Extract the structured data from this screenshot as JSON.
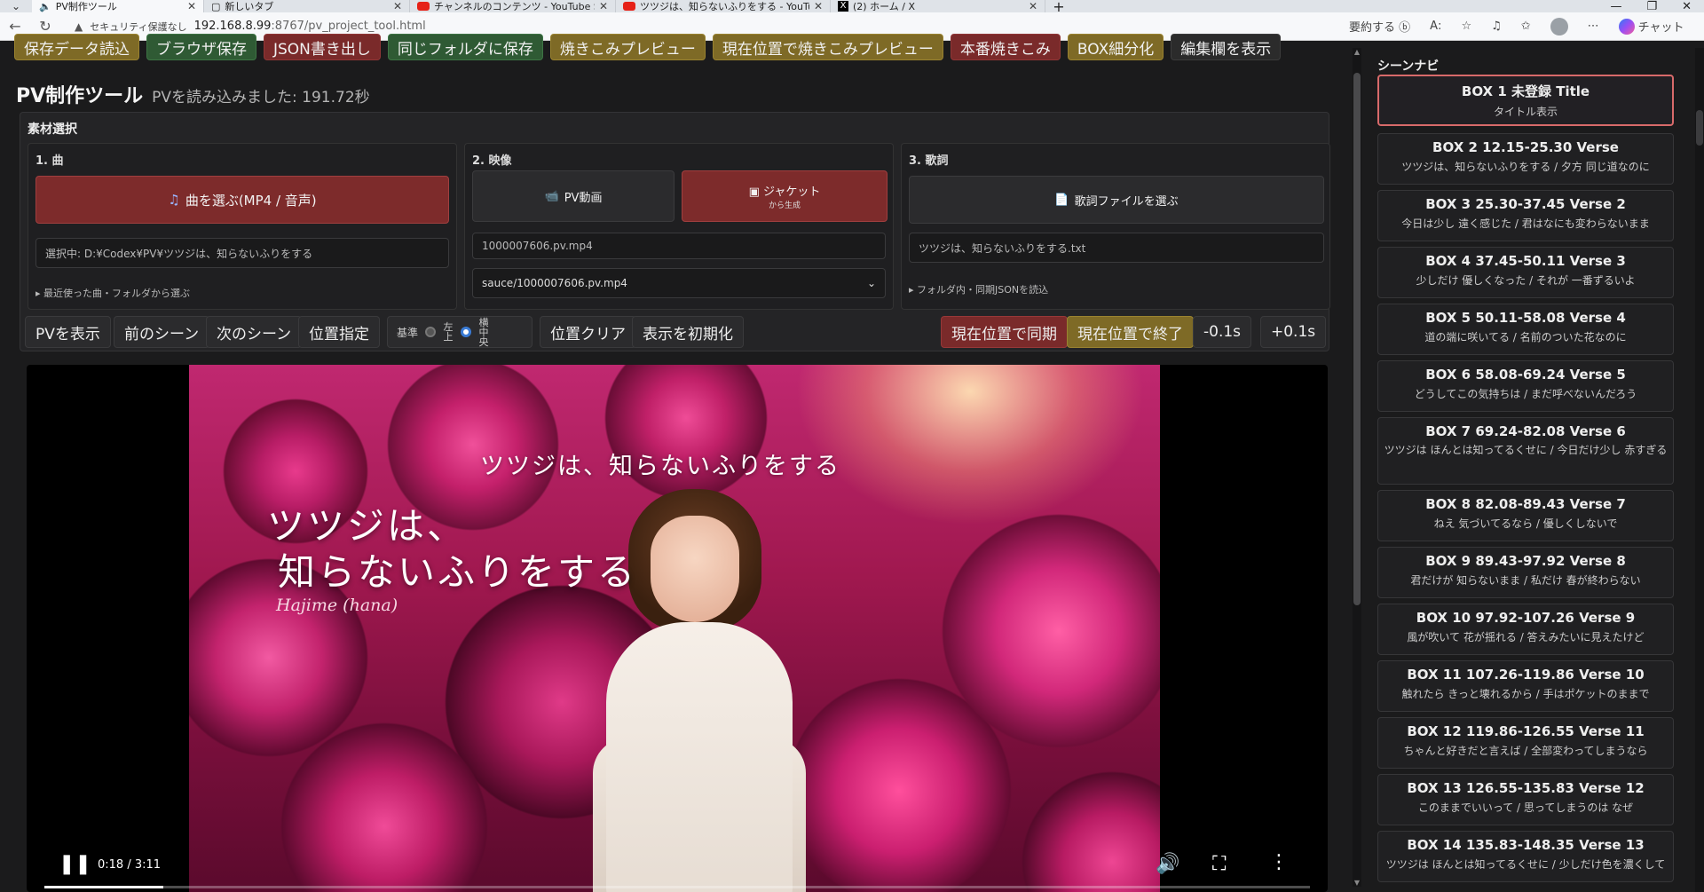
{
  "browser": {
    "tabs": [
      {
        "label": "PV制作ツール",
        "active": true,
        "icon": "speaker-icon"
      },
      {
        "label": "新しいタブ",
        "active": false,
        "icon": "page-icon"
      },
      {
        "label": "チャンネルのコンテンツ - YouTube Studio",
        "active": false,
        "icon": "youtube-icon"
      },
      {
        "label": "ツツジは、知らないふりをする - YouTube",
        "active": false,
        "icon": "youtube-icon"
      },
      {
        "label": "(2) ホーム / X",
        "active": false,
        "icon": "x-icon"
      }
    ],
    "security_label": "セキュリティ保護なし",
    "url_host": "192.168.8.99",
    "url_path": ":8767/pv_project_tool.html",
    "summarize_label": "要約する",
    "chat_label": "チャット"
  },
  "toolbar": {
    "buttons": [
      {
        "label": "保存データ読込",
        "style": "gd"
      },
      {
        "label": "ブラウザ保存",
        "style": "g"
      },
      {
        "label": "JSON書き出し",
        "style": "rd"
      },
      {
        "label": "同じフォルダに保存",
        "style": "g"
      },
      {
        "label": "焼きこみプレビュー",
        "style": "gd"
      },
      {
        "label": "現在位置で焼きこみプレビュー",
        "style": "gd"
      },
      {
        "label": "本番焼きこみ",
        "style": "rd"
      },
      {
        "label": "BOX細分化",
        "style": "gd"
      },
      {
        "label": "編集欄を表示",
        "style": "dk"
      }
    ]
  },
  "header": {
    "title": "PV制作ツール",
    "status": "PVを読み込みました: 191.72秒"
  },
  "materials": {
    "title": "素材選択",
    "song": {
      "heading": "1. 曲",
      "pick_label": "曲を選ぶ(MP4 / 音声)",
      "selected_text": "選択中: D:¥Codex¥PV¥ツツジは、知らないふりをする",
      "recent_link": "▸ 最近使った曲・フォルダから選ぶ"
    },
    "video": {
      "heading": "2. 映像",
      "pv_button": "PV動画",
      "jacket_button": "ジャケット",
      "jacket_sub": "から生成",
      "file_name": "1000007606.pv.mp4",
      "select_value": "sauce/1000007606.pv.mp4"
    },
    "lyrics": {
      "heading": "3. 歌詞",
      "pick_label": "歌詞ファイルを選ぶ",
      "file_name": "ツツジは、知らないふりをする.txt",
      "json_link": "▸ フォルダ内・同期JSONを読込"
    }
  },
  "controls": {
    "show_pv": "PVを表示",
    "prev_scene": "前のシーン",
    "next_scene": "次のシーン",
    "position": "位置指定",
    "basis_label": "基準",
    "radio_topleft": "左上",
    "radio_center": "横中央",
    "selected_radio": "横中央",
    "clear_position": "位置クリア",
    "reset_display": "表示を初期化",
    "sync_here": "現在位置で同期",
    "end_here": "現在位置で終了",
    "minus": "-0.1s",
    "plus": "+0.1s"
  },
  "video": {
    "overlay_top": "ツツジは、知らないふりをする",
    "overlay_line1": "ツツジは、",
    "overlay_line2": "知らないふりをする",
    "overlay_signature": "Hajime (hana)",
    "time": "0:18 / 3:11",
    "progress": 0.094
  },
  "scene_nav": {
    "title": "シーンナビ",
    "items": [
      {
        "head": "BOX 1 未登録 Title",
        "sub": "タイトル表示",
        "active": true
      },
      {
        "head": "BOX 2 12.15-25.30 Verse",
        "sub": "ツツジは、知らないふりをする / 夕方 同じ道なのに"
      },
      {
        "head": "BOX 3 25.30-37.45 Verse 2",
        "sub": "今日は少し 遠く感じた / 君はなにも変わらないまま"
      },
      {
        "head": "BOX 4 37.45-50.11 Verse 3",
        "sub": "少しだけ 優しくなった / それが 一番ずるいよ"
      },
      {
        "head": "BOX 5 50.11-58.08 Verse 4",
        "sub": "道の端に咲いてる / 名前のついた花なのに"
      },
      {
        "head": "BOX 6 58.08-69.24 Verse 5",
        "sub": "どうしてこの気持ちは / まだ呼べないんだろう"
      },
      {
        "head": "BOX 7 69.24-82.08 Verse 6",
        "sub": "ツツジは ほんとは知ってるくせに / 今日だけ少し 赤すぎる",
        "tall": true
      },
      {
        "head": "BOX 8 82.08-89.43 Verse 7",
        "sub": "ねえ 気づいてるなら / 優しくしないで"
      },
      {
        "head": "BOX 9 89.43-97.92 Verse 8",
        "sub": "君だけが 知らないまま / 私だけ 春が終わらない"
      },
      {
        "head": "BOX 10 97.92-107.26 Verse 9",
        "sub": "風が吹いて 花が揺れる / 答えみたいに見えたけど"
      },
      {
        "head": "BOX 11 107.26-119.86 Verse 10",
        "sub": "触れたら きっと壊れるから / 手はポケットのままで"
      },
      {
        "head": "BOX 12 119.86-126.55 Verse 11",
        "sub": "ちゃんと好きだと言えば / 全部変わってしまうなら"
      },
      {
        "head": "BOX 13 126.55-135.83 Verse 12",
        "sub": "このままでいいって / 思ってしまうのは なぜ"
      },
      {
        "head": "BOX 14 135.83-148.35 Verse 13",
        "sub": "ツツジは ほんとは知ってるくせに / 少しだけ色を濃くして"
      }
    ]
  }
}
